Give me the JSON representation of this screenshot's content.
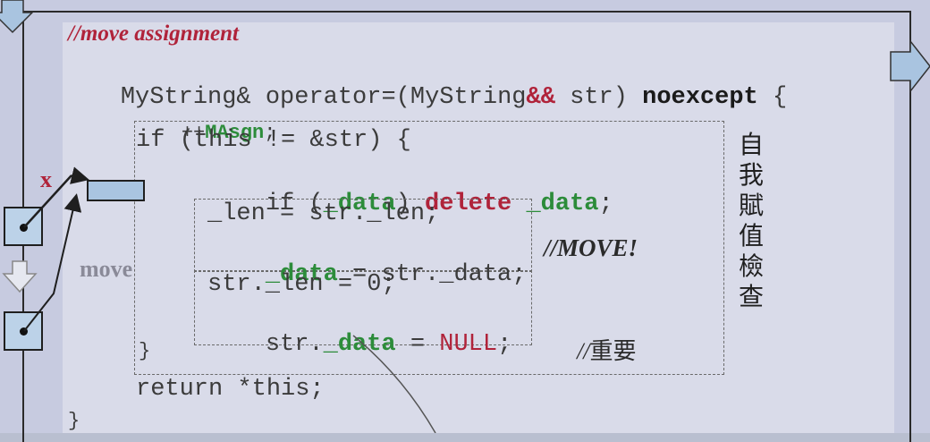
{
  "comment_heading": "//move assignment",
  "signature": {
    "part1": "MyString& operator=(MyString",
    "ampamp": "&&",
    "part2": " str) ",
    "noexcept": "noexcept",
    "brace": " {"
  },
  "line_incr": {
    "prefix": "++",
    "name": "MAsgn",
    "suffix": ";"
  },
  "line_if": "if (this != &str) {",
  "line_delete": {
    "pre": "if (",
    "data1": "_data",
    "mid": ") ",
    "del": "delete",
    "sp": " ",
    "data2": "_data",
    "end": ";"
  },
  "line_len": "_len = str._len;",
  "line_datamove": {
    "data": "_data",
    "rest": " = str._data;"
  },
  "comment_move": "//MOVE!",
  "line_strlen": "str._len = 0;",
  "line_strdata": {
    "pre": "str.",
    "data": "_data",
    "mid": " = ",
    "null": "NULL",
    "end": ";"
  },
  "comment_important": "//重要",
  "line_close_if": "}",
  "line_return": "return *this;",
  "line_close_fn": "}",
  "side_label": [
    "自",
    "我",
    "賦",
    "值",
    "檢",
    "查"
  ],
  "diagram": {
    "x_mark": "x",
    "move_label": "move"
  },
  "colors": {
    "accent_red": "#b0233a",
    "accent_green": "#2c8c3a",
    "box_fill": "#bcd2e8"
  }
}
